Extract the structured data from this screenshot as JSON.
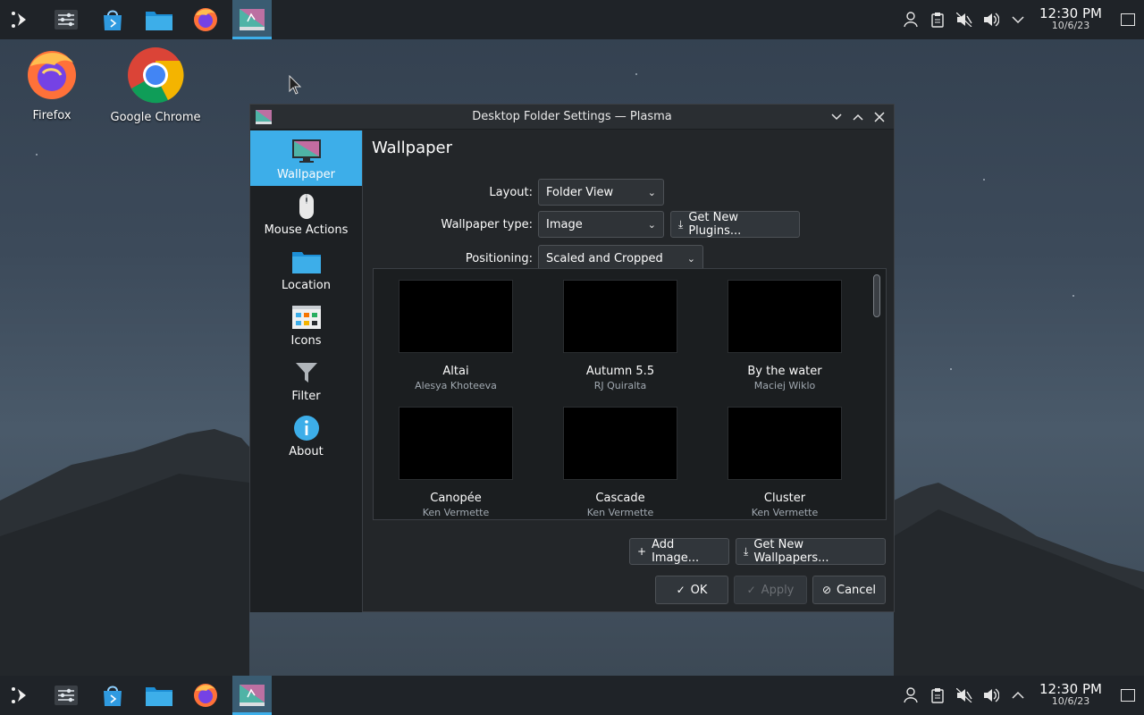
{
  "desktop": {
    "icons": [
      {
        "label": "Firefox",
        "icon": "firefox-icon"
      },
      {
        "label": "Google Chrome",
        "icon": "chrome-icon"
      }
    ]
  },
  "panel": {
    "launchers": [
      "app-launcher-icon",
      "system-settings-icon",
      "discover-store-icon",
      "dolphin-files-icon",
      "firefox-icon",
      "plasma-settings-icon"
    ],
    "tray": [
      "user-icon",
      "clipboard-icon",
      "muted-speaker-icon",
      "volume-icon"
    ],
    "top_expander": "chevron-down-icon",
    "bottom_expander": "chevron-up-icon",
    "clock_time": "12:30 PM",
    "clock_date": "10/6/23"
  },
  "window": {
    "title": "Desktop Folder Settings — Plasma",
    "controls": [
      "minimize",
      "maximize",
      "close"
    ]
  },
  "sidebar": {
    "items": [
      {
        "label": "Wallpaper",
        "icon": "wallpaper-icon",
        "selected": true
      },
      {
        "label": "Mouse Actions",
        "icon": "mouse-icon",
        "selected": false
      },
      {
        "label": "Location",
        "icon": "folder-icon",
        "selected": false
      },
      {
        "label": "Icons",
        "icon": "icons-view-icon",
        "selected": false
      },
      {
        "label": "Filter",
        "icon": "filter-icon",
        "selected": false
      },
      {
        "label": "About",
        "icon": "info-icon",
        "selected": false
      }
    ]
  },
  "main": {
    "title": "Wallpaper",
    "layout_label": "Layout:",
    "layout_value": "Folder View",
    "wallpaper_type_label": "Wallpaper type:",
    "wallpaper_type_value": "Image",
    "get_plugins_label": "Get New Plugins...",
    "positioning_label": "Positioning:",
    "positioning_value": "Scaled and Cropped",
    "wallpapers": [
      {
        "name": "Altai",
        "author": "Alesya Khoteeva"
      },
      {
        "name": "Autumn 5.5",
        "author": "RJ Quiralta"
      },
      {
        "name": "By the water",
        "author": "Maciej Wiklo"
      },
      {
        "name": "Canopée",
        "author": "Ken Vermette"
      },
      {
        "name": "Cascade",
        "author": "Ken Vermette"
      },
      {
        "name": "Cluster",
        "author": "Ken Vermette"
      }
    ],
    "add_image_label": "Add Image...",
    "get_wallpapers_label": "Get New Wallpapers...",
    "ok_label": "OK",
    "apply_label": "Apply",
    "cancel_label": "Cancel"
  },
  "colors": {
    "accent": "#3daee9",
    "panel_bg": "#1f2328",
    "window_bg": "#232629"
  }
}
